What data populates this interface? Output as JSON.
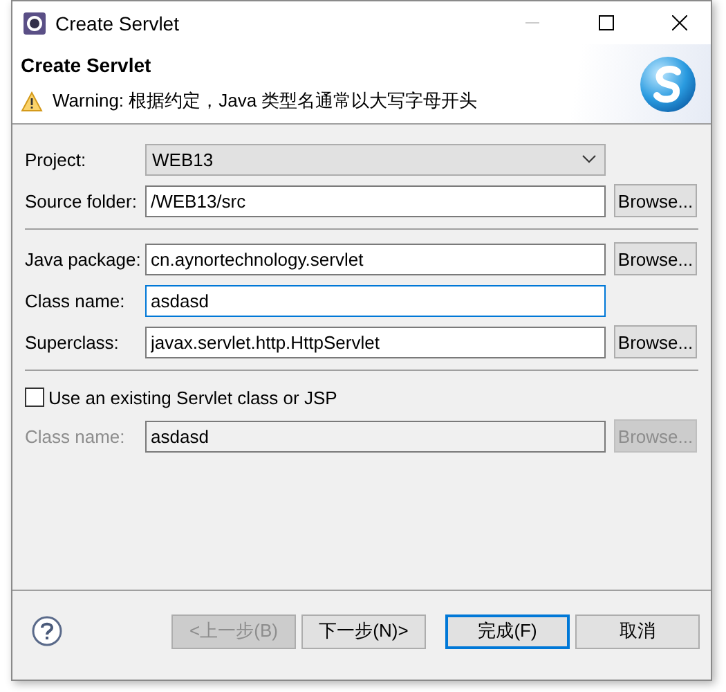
{
  "window": {
    "title": "Create Servlet"
  },
  "header": {
    "title": "Create Servlet",
    "warning": "Warning: 根据约定，Java 类型名通常以大写字母开头"
  },
  "rows": [
    {
      "kind": "select",
      "label": "Project:",
      "value": "WEB13"
    },
    {
      "kind": "text",
      "label": "Source folder:",
      "value": "/WEB13/src",
      "button": "Browse...",
      "disabled": false,
      "focused": false
    },
    {
      "kind": "separator"
    },
    {
      "kind": "text",
      "label": "Java package:",
      "value": "cn.aynortechnology.servlet",
      "button": "Browse...",
      "disabled": false,
      "focused": false
    },
    {
      "kind": "text",
      "label": "Class name:",
      "value": "asdasd",
      "disabled": false,
      "focused": true
    },
    {
      "kind": "text",
      "label": "Superclass:",
      "value": "javax.servlet.http.HttpServlet",
      "button": "Browse...",
      "disabled": false,
      "focused": false
    },
    {
      "kind": "separator"
    },
    {
      "kind": "checkbox",
      "label": "Use an existing Servlet class or JSP",
      "checked": false
    },
    {
      "kind": "text",
      "label": "Class name:",
      "value": "asdasd",
      "button": "Browse...",
      "disabled": true,
      "focused": false
    }
  ],
  "buttons": [
    {
      "label": "<上一步(B)",
      "disabled": true,
      "default": false
    },
    {
      "label": "下一步(N)>",
      "disabled": false,
      "default": false
    },
    {
      "label": "完成(F)",
      "disabled": false,
      "default": true
    },
    {
      "label": "取消",
      "disabled": false,
      "default": false
    }
  ]
}
